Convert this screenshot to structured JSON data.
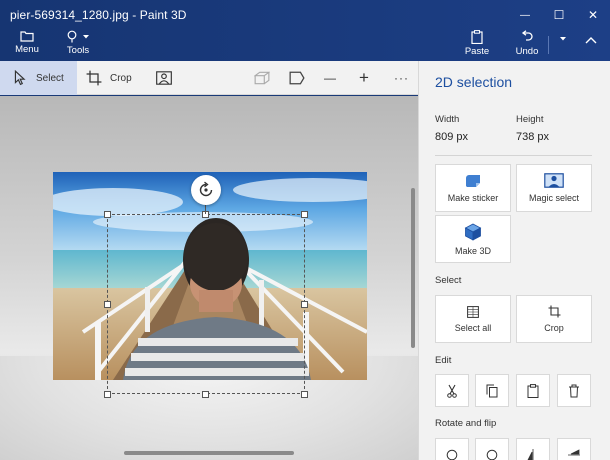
{
  "window": {
    "title": "pier-569314_1280.jpg - Paint 3D",
    "minimize_glyph": "—",
    "maximize_glyph": "☐",
    "close_glyph": "✕"
  },
  "header": {
    "menu_label": "Menu",
    "tools_label": "Tools",
    "paste_label": "Paste",
    "undo_label": "Undo"
  },
  "toolbar": {
    "select_label": "Select",
    "crop_label": "Crop",
    "minus_glyph": "—",
    "plus_glyph": "+",
    "more_glyph": "···"
  },
  "panel": {
    "title": "2D selection",
    "width_label": "Width",
    "width_value": "809 px",
    "height_label": "Height",
    "height_value": "738 px",
    "make_sticker_label": "Make sticker",
    "magic_select_label": "Magic select",
    "make_3d_label": "Make 3D",
    "select_section": "Select",
    "select_all_label": "Select all",
    "crop_label": "Crop",
    "edit_section": "Edit",
    "rotate_section": "Rotate and flip"
  },
  "colors": {
    "accent": "#1d4fa0",
    "header_bg": "#1a3a78",
    "selected_tool_bg": "#cfd9ef"
  }
}
